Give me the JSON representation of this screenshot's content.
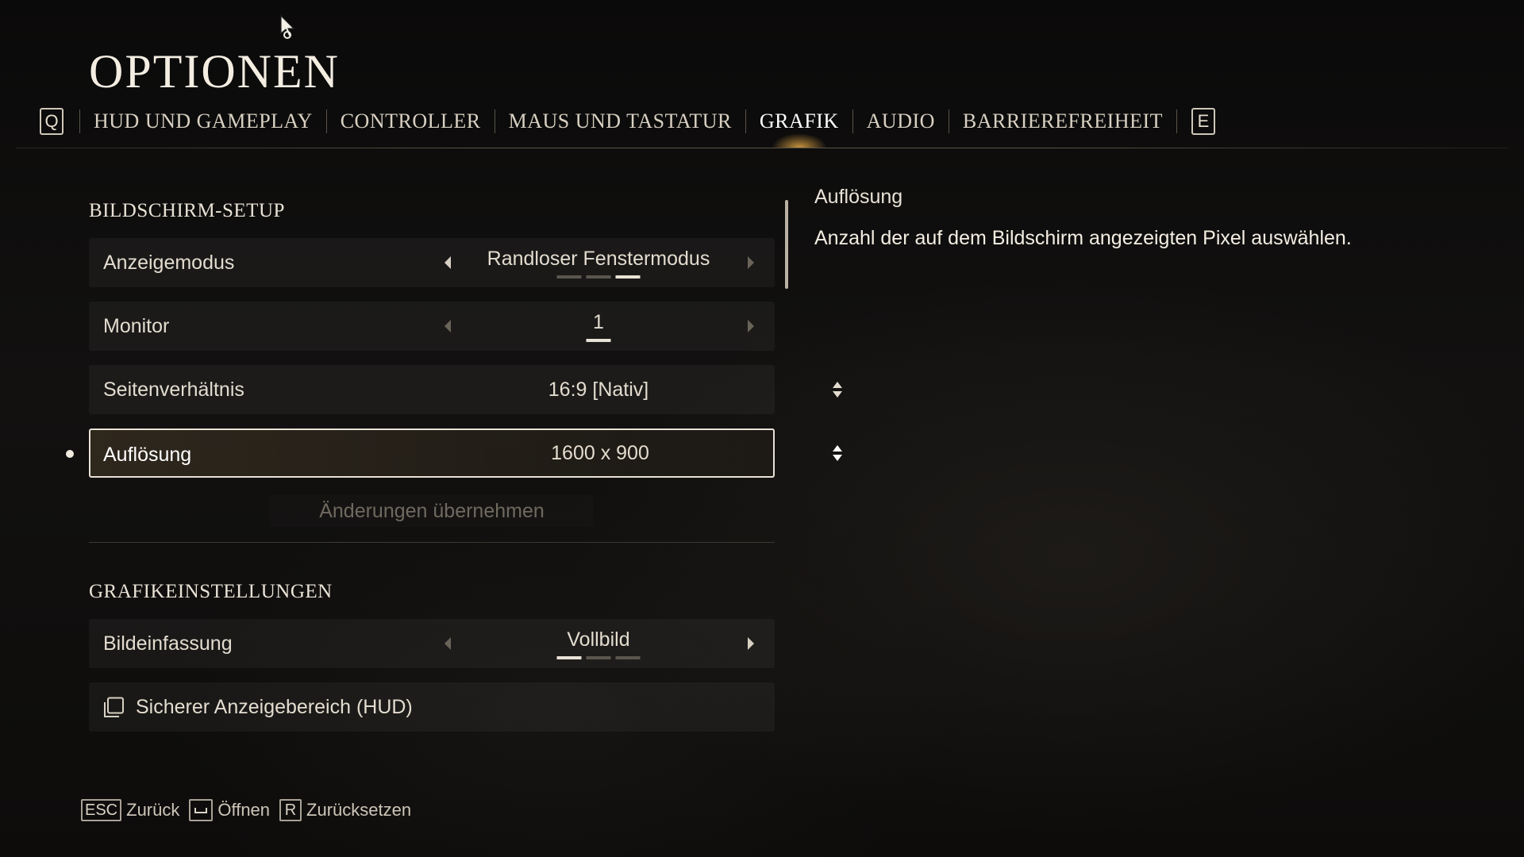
{
  "title": "OPTIONEN",
  "tabs": {
    "prev_key": "Q",
    "next_key": "E",
    "items": [
      {
        "label": "HUD UND GAMEPLAY"
      },
      {
        "label": "CONTROLLER"
      },
      {
        "label": "MAUS UND TASTATUR"
      },
      {
        "label": "GRAFIK",
        "active": true
      },
      {
        "label": "AUDIO"
      },
      {
        "label": "BARRIEREFREIHEIT"
      }
    ]
  },
  "sections": {
    "screen_setup": {
      "heading": "BILDSCHIRM-SETUP",
      "display_mode": {
        "label": "Anzeigemodus",
        "value": "Randloser Fenstermodus",
        "option_count": 3,
        "selected_index": 2
      },
      "monitor": {
        "label": "Monitor",
        "value": "1",
        "option_count": 1,
        "selected_index": 0
      },
      "aspect_ratio": {
        "label": "Seitenverhältnis",
        "value": "16:9 [Nativ]"
      },
      "resolution": {
        "label": "Auflösung",
        "value": "1600 x 900"
      },
      "apply_label": "Änderungen übernehmen"
    },
    "graphics": {
      "heading": "GRAFIKEINSTELLUNGEN",
      "frame": {
        "label": "Bildeinfassung",
        "value": "Vollbild",
        "option_count": 3,
        "selected_index": 0
      },
      "safe_area": {
        "label": "Sicherer Anzeigebereich (HUD)"
      }
    }
  },
  "info": {
    "title": "Auflösung",
    "description": "Anzahl der auf dem Bildschirm angezeigten Pixel auswählen."
  },
  "footer": {
    "back_key": "ESC",
    "back_label": "Zurück",
    "open_icon": "spacebar-icon",
    "open_label": "Öffnen",
    "reset_key": "R",
    "reset_label": "Zurücksetzen"
  },
  "colors": {
    "background": "#0c0b0a",
    "text": "#e9e2d6",
    "active_tab_glow": "#e6aa46",
    "disabled_text": "#6f695f"
  }
}
